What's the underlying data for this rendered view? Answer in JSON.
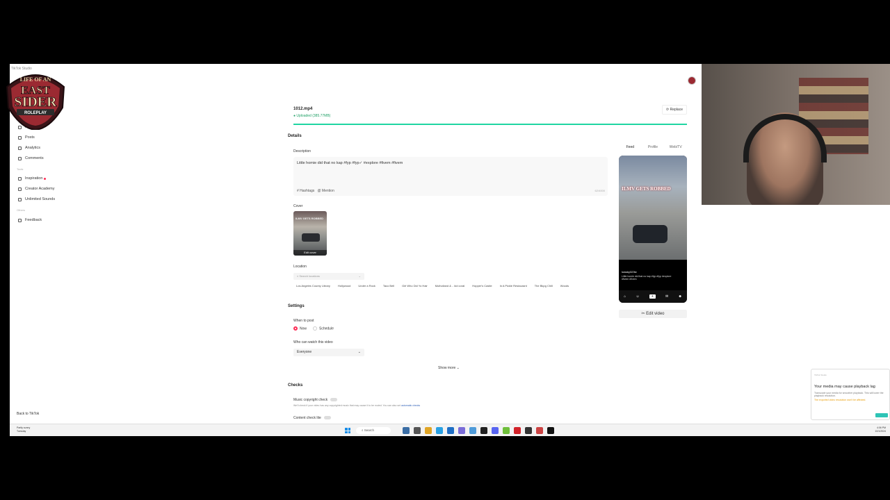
{
  "app": {
    "brand_label": "TikTok Studio"
  },
  "sidebar": {
    "items": [
      {
        "label": "Home",
        "top": "0"
      },
      {
        "label": "Posts"
      },
      {
        "label": "Analytics"
      },
      {
        "label": "Comments"
      }
    ],
    "tools_header": "Tools",
    "tools": [
      {
        "label": "Inspiration"
      },
      {
        "label": "Creator Academy"
      },
      {
        "label": "Unlimited Sounds"
      }
    ],
    "others_header": "Others",
    "others": [
      {
        "label": "Feedback"
      }
    ],
    "back_label": "Back to TikTok"
  },
  "logo": {
    "line1": "LIFE OF AN",
    "line2": "EAST",
    "line3": "SIDER",
    "line4": "ROLEPLAY"
  },
  "upload": {
    "file_name": "1012.mp4",
    "status": "Uploaded (385.77MB)",
    "replace_label": "Replace",
    "progress": 1.0
  },
  "details": {
    "title": "Details",
    "description_label": "Description",
    "description_text": "Little homie did that no kap #fyp #fyp✓ #explore #fivem #fivem",
    "hashtags_label": "# Hashtags",
    "mention_label": "@ Mention",
    "char_count": "62/4000",
    "cover_label": "Cover",
    "cover_edit": "Edit cover",
    "cover_title": "ILMV GETS ROBBED",
    "location_label": "Location",
    "location_placeholder": "Search locations",
    "location_chips": [
      "Los Angeles County Library",
      "Hollywood",
      "Under a Rock",
      "Taco Bell",
      "Girl Who Did Yo Hair",
      "Mulholland & .. kid coral",
      "Hopper's Castle",
      "In A Pickle Restaurant",
      "The Bkpg Chill",
      "Woods"
    ]
  },
  "settings": {
    "title": "Settings",
    "when_label": "When to post",
    "now_label": "Now",
    "schedule_label": "Schedule",
    "who_label": "Who can watch this video",
    "who_value": "Everyone",
    "show_more": "Show more"
  },
  "checks": {
    "title": "Checks",
    "music_label": "Music copyright check",
    "music_desc": "We'll check if your video has any copyrighted music that may cause it to be muted. You can also set",
    "music_link": "automatic checks",
    "content_label": "Content check lite"
  },
  "preview": {
    "tabs": [
      "Feed",
      "Profile",
      "Web/TV"
    ],
    "active_tab": 0,
    "overlay_title": "ILMV GETS ROBBED",
    "user": "lowsky323tv",
    "caption": "Little homie did that no kap #fyp #fyp #explore #fivem #fivem",
    "nav": [
      "Home",
      "Friends",
      "+",
      "Inbox",
      "Me"
    ],
    "edit_label": "Edit video"
  },
  "toast": {
    "tiny": "TikTok Studio",
    "title": "Your media may cause playback lag",
    "sub": "Transcode your media for smoother playback. This will lower the playback resolution.",
    "warn": "The exported video resolution won't be affected."
  },
  "taskbar": {
    "weather_temp": "Partly sunny",
    "weather_day": "Tuesday",
    "search_label": "Search",
    "time": "4:06 PM",
    "date": "10/1/2024"
  },
  "colors": {
    "accent": "#fe2c55",
    "success": "#20d5a2",
    "link": "#2b5db5"
  }
}
